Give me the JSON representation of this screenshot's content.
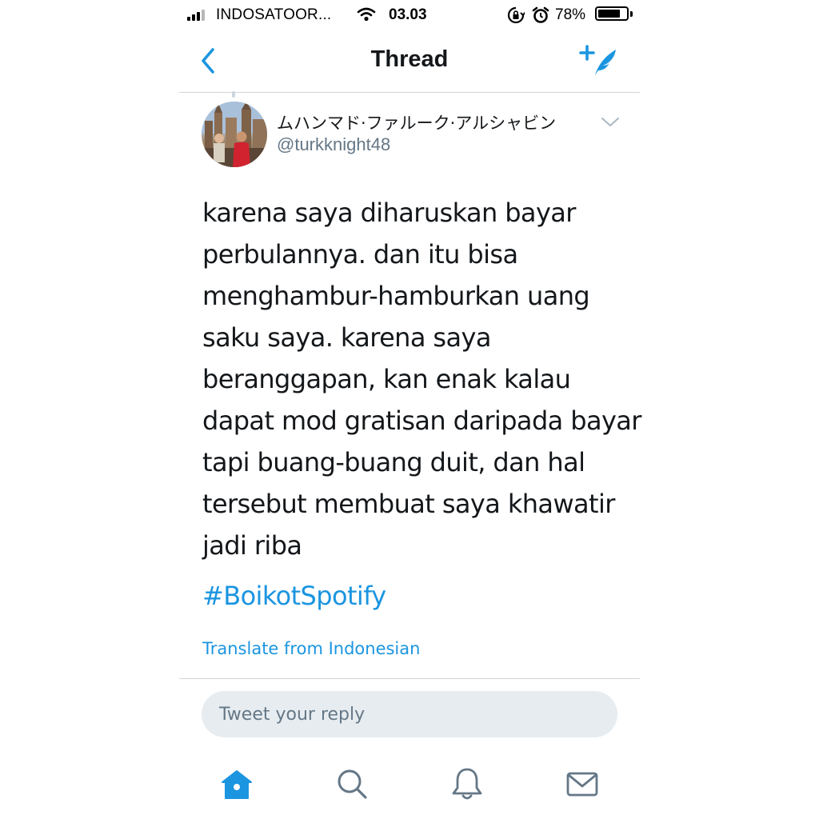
{
  "status_bar": {
    "carrier": "INDOSATOOR...",
    "time": "03.03",
    "battery_percent": "78%",
    "battery_level": 0.78,
    "signal_icon": "cellular-signal-icon",
    "wifi_icon": "wifi-icon",
    "lock_icon": "orientation-lock-icon",
    "alarm_icon": "alarm-icon"
  },
  "nav": {
    "title": "Thread",
    "back_icon": "chevron-left-icon",
    "compose_icon": "compose-tweet-icon"
  },
  "tweet": {
    "display_name": "ムハンマド·ファルーク·アルシャビン",
    "handle": "@turkknight48",
    "text_lines": [
      "karena saya diharuskan bayar",
      "perbulannya. dan itu bisa",
      "menghambur-hamburkan uang",
      "saku saya. karena saya",
      "beranggapan, kan enak kalau",
      "dapat mod gratisan daripada bayar",
      "tapi buang-buang duit, dan hal",
      "tersebut membuat saya khawatir",
      "jadi riba"
    ],
    "hashtag": "#BoikotSpotify",
    "translate_label": "Translate from Indonesian"
  },
  "reply": {
    "placeholder": "Tweet your reply"
  },
  "tab_bar": {
    "items": [
      "home-icon",
      "search-icon",
      "notifications-icon",
      "messages-icon"
    ],
    "active": "home-icon"
  },
  "colors": {
    "accent": "#1b95e0",
    "text": "#14171a",
    "secondary": "#657786",
    "reply_bg": "#e6ecf0",
    "divider": "#d0d6db"
  }
}
